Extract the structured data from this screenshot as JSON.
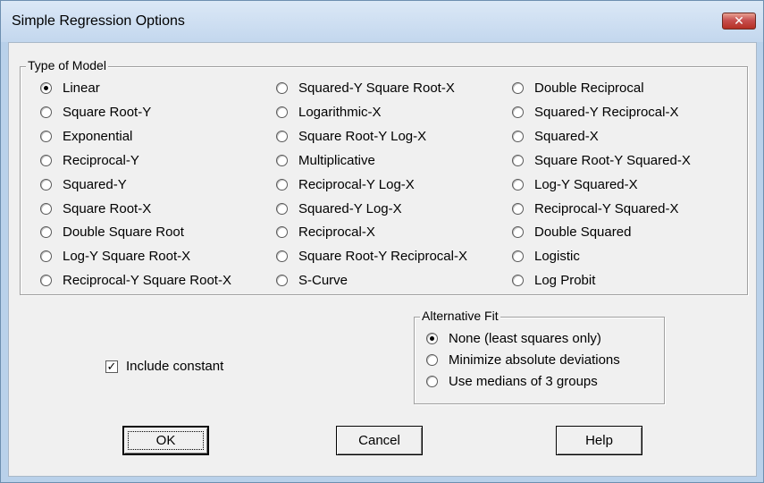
{
  "dialog": {
    "title": "Simple Regression Options",
    "close_glyph": "✕"
  },
  "type_of_model": {
    "legend": "Type of Model",
    "selected": "Linear",
    "columns": [
      [
        "Linear",
        "Square Root-Y",
        "Exponential",
        "Reciprocal-Y",
        "Squared-Y",
        "Square Root-X",
        "Double Square Root",
        "Log-Y Square Root-X",
        "Reciprocal-Y Square Root-X"
      ],
      [
        "Squared-Y Square Root-X",
        "Logarithmic-X",
        "Square Root-Y Log-X",
        "Multiplicative",
        "Reciprocal-Y Log-X",
        "Squared-Y Log-X",
        "Reciprocal-X",
        "Square Root-Y Reciprocal-X",
        "S-Curve"
      ],
      [
        "Double Reciprocal",
        "Squared-Y Reciprocal-X",
        "Squared-X",
        "Square Root-Y Squared-X",
        "Log-Y Squared-X",
        "Reciprocal-Y Squared-X",
        "Double Squared",
        "Logistic",
        "Log Probit"
      ]
    ]
  },
  "alternative_fit": {
    "legend": "Alternative Fit",
    "selected": "None (least squares only)",
    "options": [
      "None (least squares only)",
      "Minimize absolute deviations",
      "Use medians of 3 groups"
    ]
  },
  "include_constant": {
    "label": "Include constant",
    "checked": true,
    "check_glyph": "✓"
  },
  "buttons": {
    "ok": "OK",
    "cancel": "Cancel",
    "help": "Help"
  },
  "colors": {
    "title_bar": "#c3d7ee",
    "client_bg": "#f0f0f0",
    "close_button": "#c75050"
  }
}
